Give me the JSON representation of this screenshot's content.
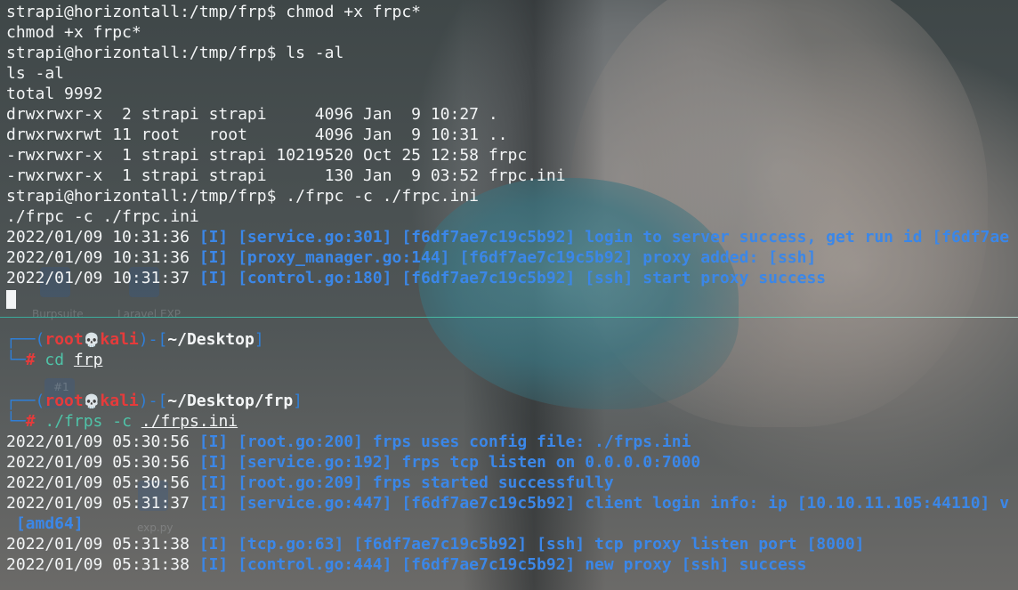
{
  "desktop": {
    "icon_labels": [
      "Burpsuite",
      "Laravel EXP",
      "exp.py",
      "#1"
    ]
  },
  "top_terminal": {
    "lines": [
      "strapi@horizontall:/tmp/frp$ chmod +x frpc*",
      "chmod +x frpc*",
      "strapi@horizontall:/tmp/frp$ ls -al",
      "ls -al",
      "total 9992",
      "drwxrwxr-x  2 strapi strapi     4096 Jan  9 10:27 .",
      "drwxrwxrwt 11 root   root       4096 Jan  9 10:31 ..",
      "-rwxrwxr-x  1 strapi strapi 10219520 Oct 25 12:58 frpc",
      "-rwxrwxr-x  1 strapi strapi      130 Jan  9 03:52 frpc.ini",
      "strapi@horizontall:/tmp/frp$ ./frpc -c ./frpc.ini",
      "./frpc -c ./frpc.ini"
    ],
    "logs": [
      {
        "ts": "2022/01/09 10:31:36",
        "msg": " [I] [service.go:301] [f6df7ae7c19c5b92] login to server success, get run id [f6df7ae"
      },
      {
        "ts": "2022/01/09 10:31:36",
        "msg": " [I] [proxy_manager.go:144] [f6df7ae7c19c5b92] proxy added: [ssh]"
      },
      {
        "ts": "2022/01/09 10:31:37",
        "msg": " [I] [control.go:180] [f6df7ae7c19c5b92] [ssh] start proxy success"
      }
    ]
  },
  "bottom_terminal": {
    "prompt_user": "root",
    "prompt_host": "kali",
    "skull": "💀",
    "prompts": [
      {
        "path": "~/Desktop",
        "cmd": "cd",
        "arg": "frp"
      },
      {
        "path": "~/Desktop/frp",
        "cmd": "./frps -c",
        "arg": "./frps.ini"
      }
    ],
    "logs": [
      {
        "ts": "2022/01/09 05:30:56",
        "msg": " [I] [root.go:200] frps uses config file: ./frps.ini"
      },
      {
        "ts": "2022/01/09 05:30:56",
        "msg": " [I] [service.go:192] frps tcp listen on 0.0.0.0:7000"
      },
      {
        "ts": "2022/01/09 05:30:56",
        "msg": " [I] [root.go:209] frps started successfully"
      },
      {
        "ts": "2022/01/09 05:31:37",
        "msg": " [I] [service.go:447] [f6df7ae7c19c5b92] client login info: ip [10.10.11.105:44110] v"
      },
      {
        "ts": "",
        "msg": " [amd64]"
      },
      {
        "ts": "2022/01/09 05:31:38",
        "msg": " [I] [tcp.go:63] [f6df7ae7c19c5b92] [ssh] tcp proxy listen port [8000]"
      },
      {
        "ts": "2022/01/09 05:31:38",
        "msg": " [I] [control.go:444] [f6df7ae7c19c5b92] new proxy [ssh] success"
      }
    ]
  }
}
